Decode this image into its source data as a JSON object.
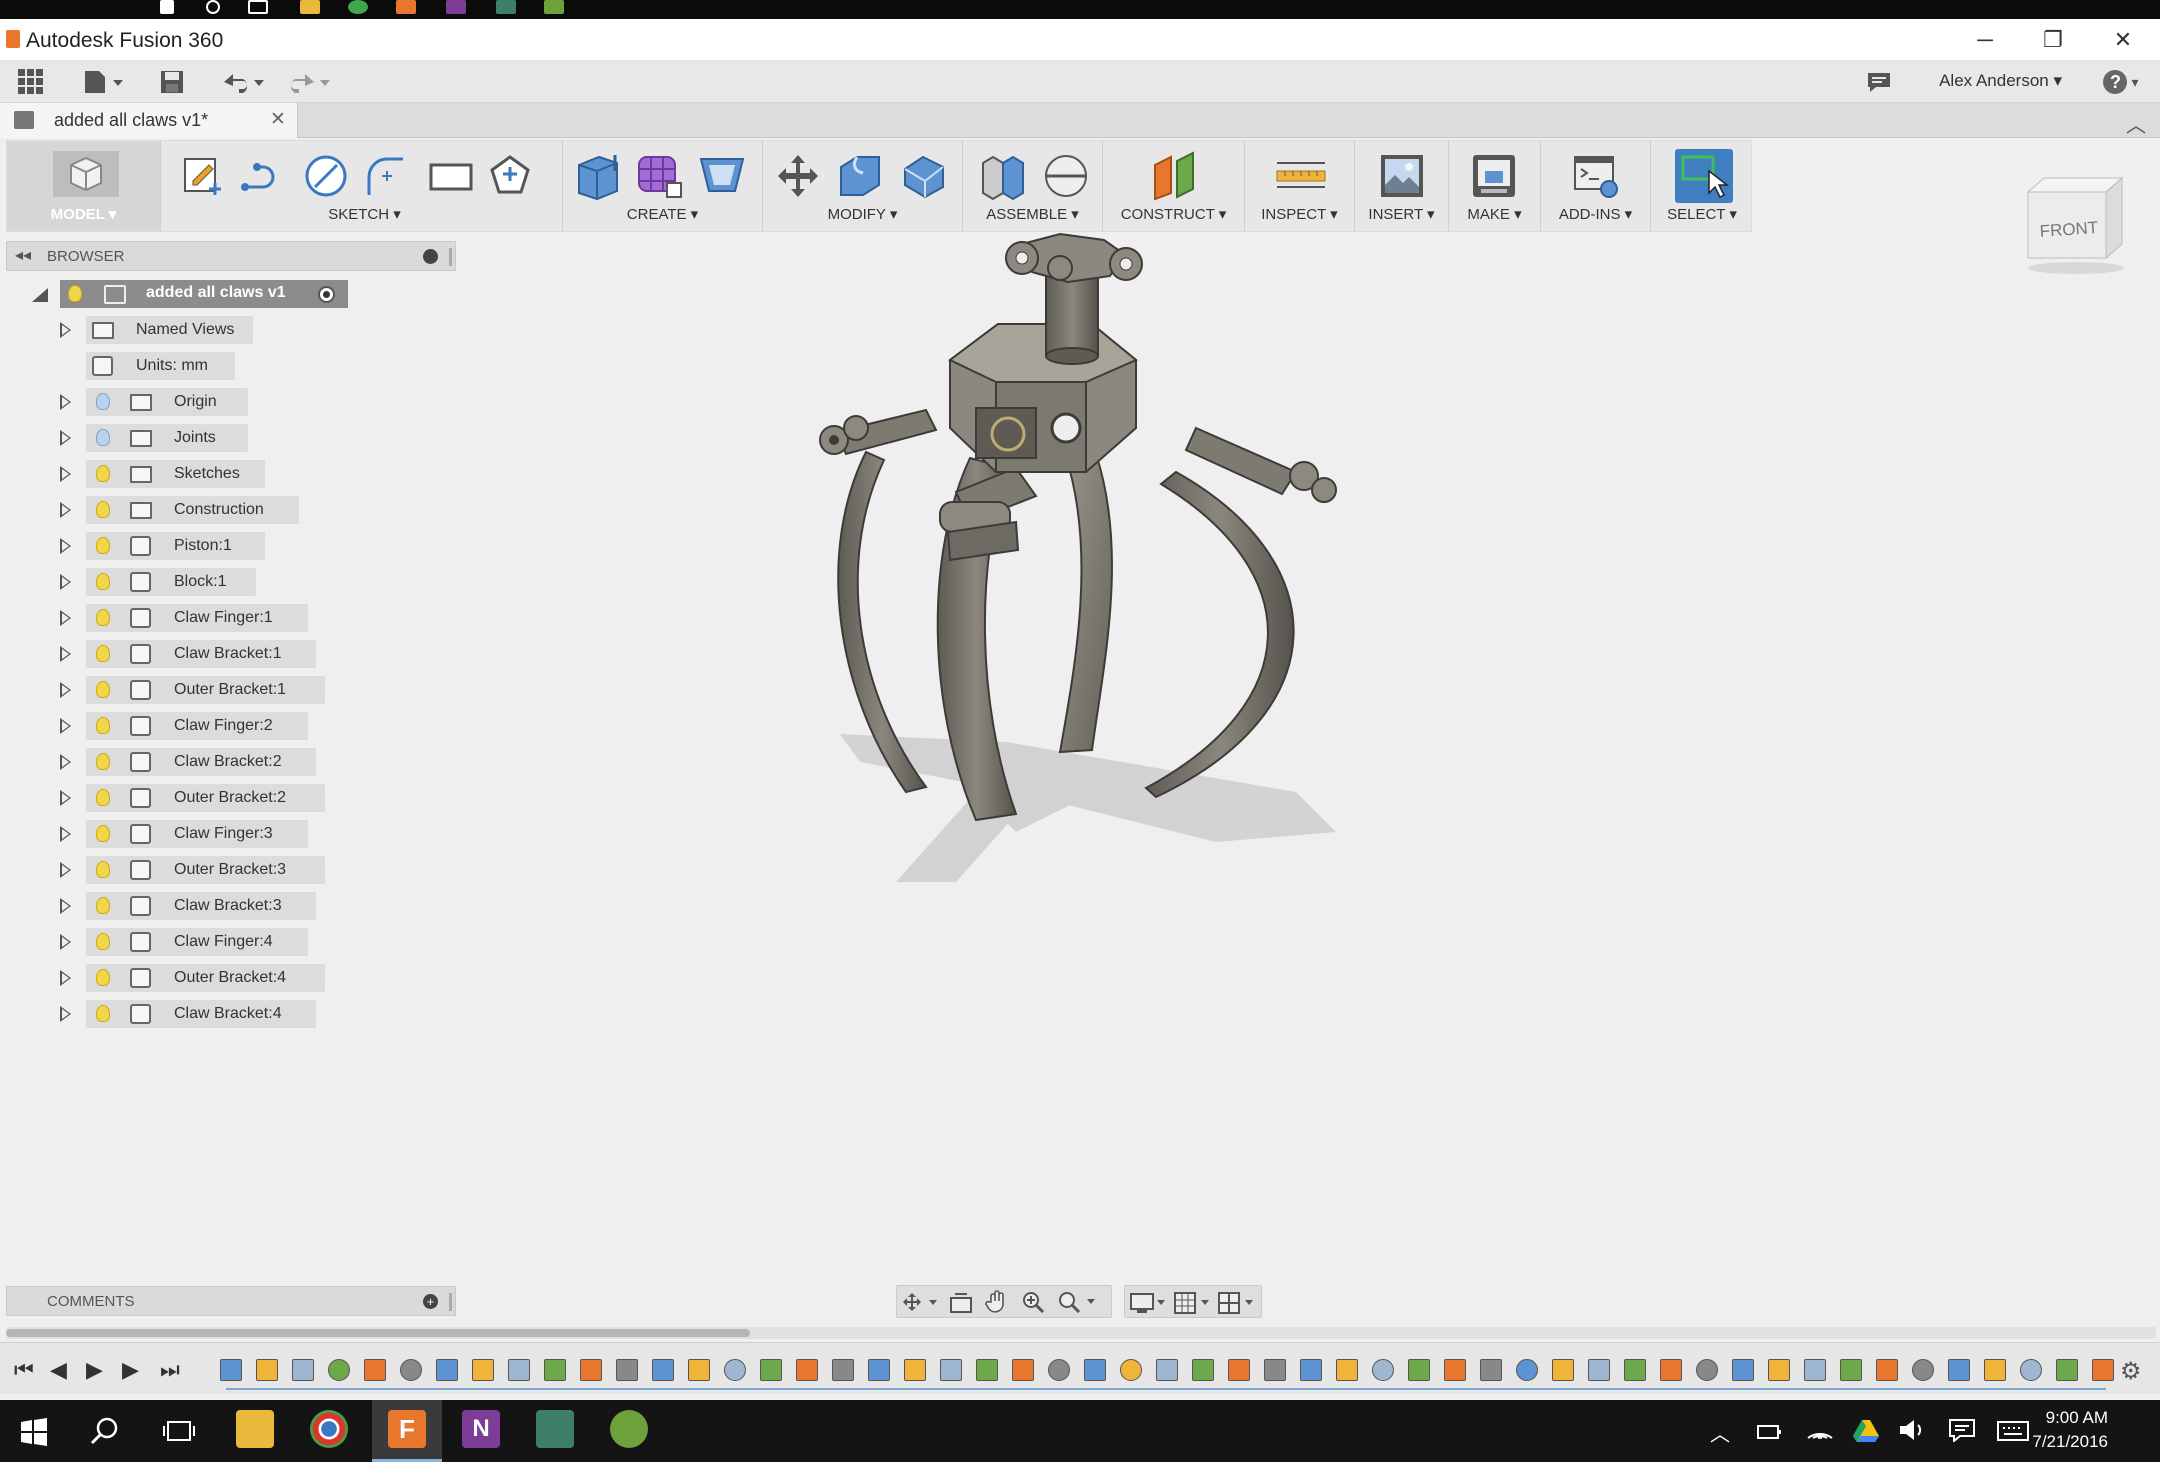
{
  "app": {
    "title": "Autodesk Fusion 360",
    "user": "Alex Anderson",
    "help": "?"
  },
  "window_controls": {
    "minimize": "─",
    "restore": "❐",
    "close": "✕"
  },
  "document_tab": {
    "label": "added all claws v1*",
    "close": "✕"
  },
  "toolbar": {
    "workspace": "MODEL",
    "groups": [
      {
        "label": "SKETCH"
      },
      {
        "label": "CREATE"
      },
      {
        "label": "MODIFY"
      },
      {
        "label": "ASSEMBLE"
      },
      {
        "label": "CONSTRUCT"
      },
      {
        "label": "INSPECT"
      },
      {
        "label": "INSERT"
      },
      {
        "label": "MAKE"
      },
      {
        "label": "ADD-INS"
      },
      {
        "label": "SELECT"
      }
    ]
  },
  "browser": {
    "title": "BROWSER",
    "root": "added all claws v1",
    "items": [
      {
        "label": "Named Views",
        "icon": "folder-icon",
        "bulb": "none",
        "expandable": true
      },
      {
        "label": "Units: mm",
        "icon": "document-icon",
        "bulb": "none",
        "expandable": false
      },
      {
        "label": "Origin",
        "icon": "folder-icon",
        "bulb": "off",
        "expandable": true
      },
      {
        "label": "Joints",
        "icon": "folder-icon",
        "bulb": "off",
        "expandable": true
      },
      {
        "label": "Sketches",
        "icon": "folder-icon",
        "bulb": "on",
        "expandable": true
      },
      {
        "label": "Construction",
        "icon": "folder-icon",
        "bulb": "on",
        "expandable": true
      },
      {
        "label": "Piston:1",
        "icon": "component-icon",
        "bulb": "on",
        "expandable": true
      },
      {
        "label": "Block:1",
        "icon": "component-icon",
        "bulb": "on",
        "expandable": true
      },
      {
        "label": "Claw Finger:1",
        "icon": "component-icon",
        "bulb": "on",
        "expandable": true
      },
      {
        "label": "Claw Bracket:1",
        "icon": "component-icon",
        "bulb": "on",
        "expandable": true
      },
      {
        "label": "Outer Bracket:1",
        "icon": "component-icon",
        "bulb": "on",
        "expandable": true
      },
      {
        "label": "Claw Finger:2",
        "icon": "component-icon",
        "bulb": "on",
        "expandable": true
      },
      {
        "label": "Claw Bracket:2",
        "icon": "component-icon",
        "bulb": "on",
        "expandable": true
      },
      {
        "label": "Outer Bracket:2",
        "icon": "component-icon",
        "bulb": "on",
        "expandable": true
      },
      {
        "label": "Claw Finger:3",
        "icon": "component-icon",
        "bulb": "on",
        "expandable": true
      },
      {
        "label": "Outer Bracket:3",
        "icon": "component-icon",
        "bulb": "on",
        "expandable": true
      },
      {
        "label": "Claw Bracket:3",
        "icon": "component-icon",
        "bulb": "on",
        "expandable": true
      },
      {
        "label": "Claw Finger:4",
        "icon": "component-icon",
        "bulb": "on",
        "expandable": true
      },
      {
        "label": "Outer Bracket:4",
        "icon": "component-icon",
        "bulb": "on",
        "expandable": true
      },
      {
        "label": "Claw Bracket:4",
        "icon": "component-icon",
        "bulb": "on",
        "expandable": true
      }
    ]
  },
  "viewcube": {
    "face": "FRONT"
  },
  "comments": {
    "title": "COMMENTS"
  },
  "taskbar": {
    "time": "9:00 AM",
    "date": "7/21/2016"
  },
  "colors": {
    "accent_select": "#3f7fbf",
    "model_grey": "#7d7a72",
    "bulb_on": "#f1d64a",
    "bulb_off": "#b9d3ec"
  }
}
